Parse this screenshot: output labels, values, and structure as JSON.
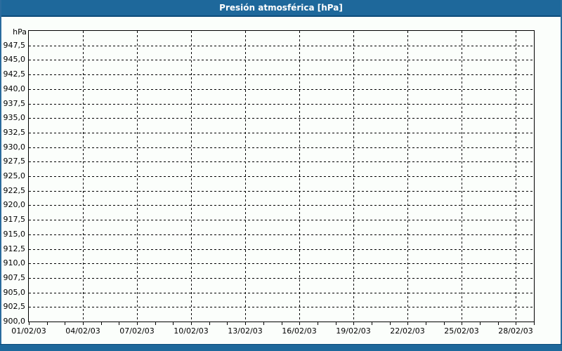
{
  "window": {
    "title": "Presión atmosférica [hPa]"
  },
  "colors": {
    "titlebar_bg": "#1E689B",
    "titlebar_border": "#0D4C7A",
    "panel_border": "#2A6C9E",
    "content_bg": "#FBFEFB",
    "grid_color": "#000000",
    "text_color": "#000000",
    "title_text": "#FFFFFF"
  },
  "chart_data": {
    "type": "line",
    "title": "Presión atmosférica [hPa]",
    "ylabel_unit": "hPa",
    "ylim": [
      900,
      950
    ],
    "y_tick_step": 2.5,
    "y_tick_labels": [
      "947,5",
      "945,0",
      "942,5",
      "940,0",
      "937,5",
      "935,0",
      "932,5",
      "930,0",
      "927,5",
      "925,0",
      "922,5",
      "920,0",
      "917,5",
      "915,0",
      "912,5",
      "910,0",
      "907,5",
      "905,0",
      "902,5",
      "900,0"
    ],
    "x_tick_labels": [
      "01/02/03",
      "04/02/03",
      "07/02/03",
      "10/02/03",
      "13/02/03",
      "16/02/03",
      "19/02/03",
      "22/02/03",
      "25/02/03",
      "28/02/03"
    ],
    "x_days_total": 28,
    "x_label_every_days": 3,
    "x_minor_tick_every_days": 1,
    "grid": "dashed",
    "legend": "none",
    "series": []
  }
}
